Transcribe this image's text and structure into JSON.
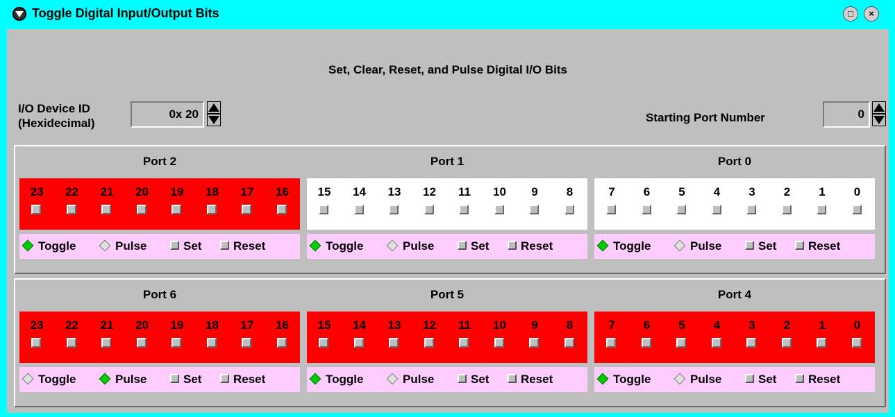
{
  "window": {
    "title": "Toggle Digital Input/Output Bits",
    "maximize_glyph": "□",
    "close_glyph": "×"
  },
  "heading": "Set, Clear, Reset, and Pulse Digital I/O Bits",
  "device_id": {
    "label_line1": "I/O Device ID",
    "label_line2": "(Hexidecimal)",
    "value": "0x 20"
  },
  "starting_port": {
    "label": "Starting Port Number",
    "value": "0"
  },
  "colors": {
    "active": "#ff0000",
    "inactive": "#ffffff",
    "selected_radio": "#00cc00",
    "mode_bar": "#ffccff"
  },
  "groups": [
    {
      "ports": [
        {
          "title": "Port 2",
          "active": true,
          "bits": [
            "23",
            "22",
            "21",
            "20",
            "19",
            "18",
            "17",
            "16"
          ],
          "mode": "Toggle",
          "modes": [
            "Toggle",
            "Pulse",
            "Set",
            "Reset"
          ]
        },
        {
          "title": "Port 1",
          "active": false,
          "bits": [
            "15",
            "14",
            "13",
            "12",
            "11",
            "10",
            "9",
            "8"
          ],
          "mode": "Toggle",
          "modes": [
            "Toggle",
            "Pulse",
            "Set",
            "Reset"
          ]
        },
        {
          "title": "Port 0",
          "active": false,
          "bits": [
            "7",
            "6",
            "5",
            "4",
            "3",
            "2",
            "1",
            "0"
          ],
          "mode": "Toggle",
          "modes": [
            "Toggle",
            "Pulse",
            "Set",
            "Reset"
          ]
        }
      ]
    },
    {
      "ports": [
        {
          "title": "Port 6",
          "active": true,
          "bits": [
            "23",
            "22",
            "21",
            "20",
            "19",
            "18",
            "17",
            "16"
          ],
          "mode": "Pulse",
          "modes": [
            "Toggle",
            "Pulse",
            "Set",
            "Reset"
          ]
        },
        {
          "title": "Port 5",
          "active": true,
          "bits": [
            "15",
            "14",
            "13",
            "12",
            "11",
            "10",
            "9",
            "8"
          ],
          "mode": "Toggle",
          "modes": [
            "Toggle",
            "Pulse",
            "Set",
            "Reset"
          ]
        },
        {
          "title": "Port 4",
          "active": true,
          "bits": [
            "7",
            "6",
            "5",
            "4",
            "3",
            "2",
            "1",
            "0"
          ],
          "mode": "Toggle",
          "modes": [
            "Toggle",
            "Pulse",
            "Set",
            "Reset"
          ]
        }
      ]
    }
  ]
}
